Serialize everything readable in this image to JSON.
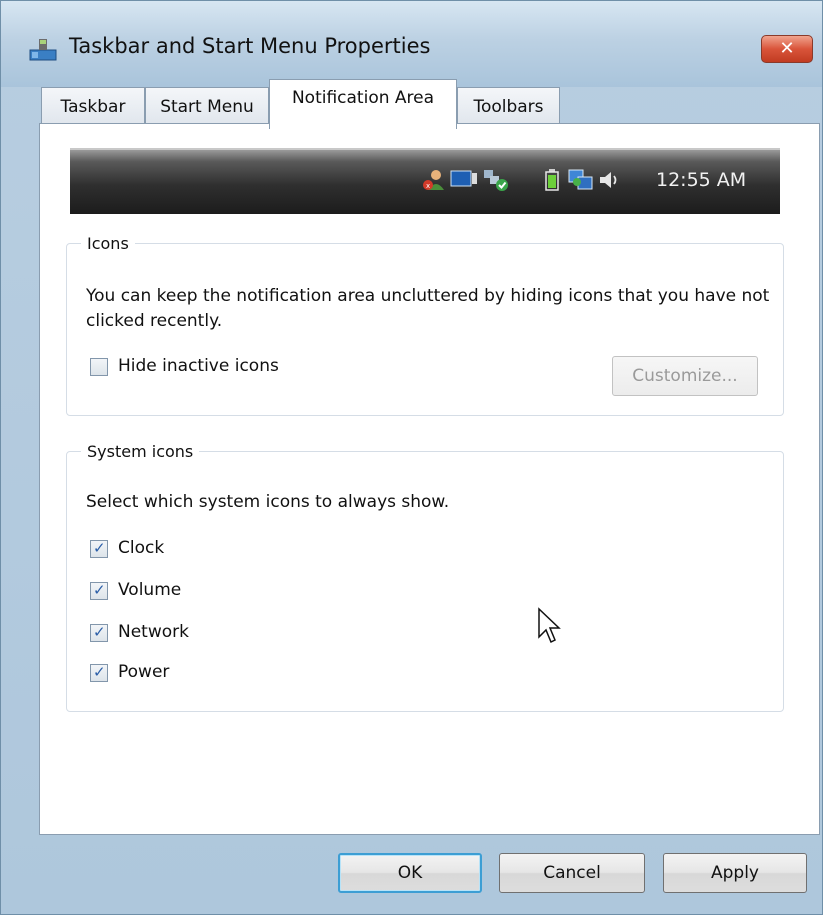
{
  "window": {
    "title": "Taskbar and Start Menu Properties",
    "close_label": "✕"
  },
  "tabs": [
    {
      "label": "Taskbar"
    },
    {
      "label": "Start Menu"
    },
    {
      "label": "Notification Area"
    },
    {
      "label": "Toolbars"
    }
  ],
  "preview": {
    "clock": "12:55 AM",
    "icons": [
      "user-alert-icon",
      "monitor-icon",
      "network-check-icon",
      "battery-icon",
      "network-icon",
      "volume-icon"
    ]
  },
  "icons_group": {
    "legend": "Icons",
    "description": "You can keep the notification area uncluttered by hiding icons that you have not clicked recently.",
    "hide_inactive": {
      "label": "Hide inactive icons",
      "checked": false
    },
    "customize_label": "Customize..."
  },
  "system_icons_group": {
    "legend": "System icons",
    "description": "Select which system icons to always show.",
    "items": [
      {
        "label": "Clock",
        "checked": true
      },
      {
        "label": "Volume",
        "checked": true
      },
      {
        "label": "Network",
        "checked": true
      },
      {
        "label": "Power",
        "checked": true
      }
    ]
  },
  "buttons": {
    "ok": "OK",
    "cancel": "Cancel",
    "apply": "Apply"
  },
  "colors": {
    "accent": "#3c9ed4",
    "close": "#d9543a",
    "taskbar": "#2f2f2f"
  }
}
